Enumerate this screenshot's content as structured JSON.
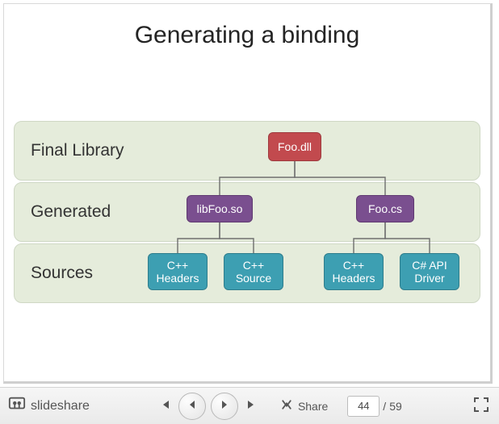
{
  "slide": {
    "title": "Generating a binding",
    "layers": {
      "final": {
        "label": "Final Library"
      },
      "generated": {
        "label": "Generated"
      },
      "sources": {
        "label": "Sources"
      }
    },
    "nodes": {
      "foodll": {
        "label": "Foo.dll",
        "layer": "final",
        "color": "red"
      },
      "libfoo": {
        "label": "libFoo.so",
        "layer": "generated",
        "color": "purple"
      },
      "foocs": {
        "label": "Foo.cs",
        "layer": "generated",
        "color": "purple"
      },
      "cpp_headers_1": {
        "label": "C++\nHeaders",
        "layer": "sources",
        "color": "teal"
      },
      "cpp_source": {
        "label": "C++\nSource",
        "layer": "sources",
        "color": "teal"
      },
      "cpp_headers_2": {
        "label": "C++\nHeaders",
        "layer": "sources",
        "color": "teal"
      },
      "cs_driver": {
        "label": "C# API\nDriver",
        "layer": "sources",
        "color": "teal"
      }
    },
    "edges": [
      [
        "foodll",
        "libfoo"
      ],
      [
        "foodll",
        "foocs"
      ],
      [
        "libfoo",
        "cpp_headers_1"
      ],
      [
        "libfoo",
        "cpp_source"
      ],
      [
        "foocs",
        "cpp_headers_2"
      ],
      [
        "foocs",
        "cs_driver"
      ]
    ]
  },
  "toolbar": {
    "brand": "slideshare",
    "share_label": "Share",
    "page_current": "44",
    "page_total": "59",
    "page_sep": " /"
  },
  "colors": {
    "band": "#e5ecdb",
    "red": "#c24a4e",
    "purple": "#7a4f8f",
    "teal": "#3d9fb2",
    "line": "#6e6e6e"
  }
}
